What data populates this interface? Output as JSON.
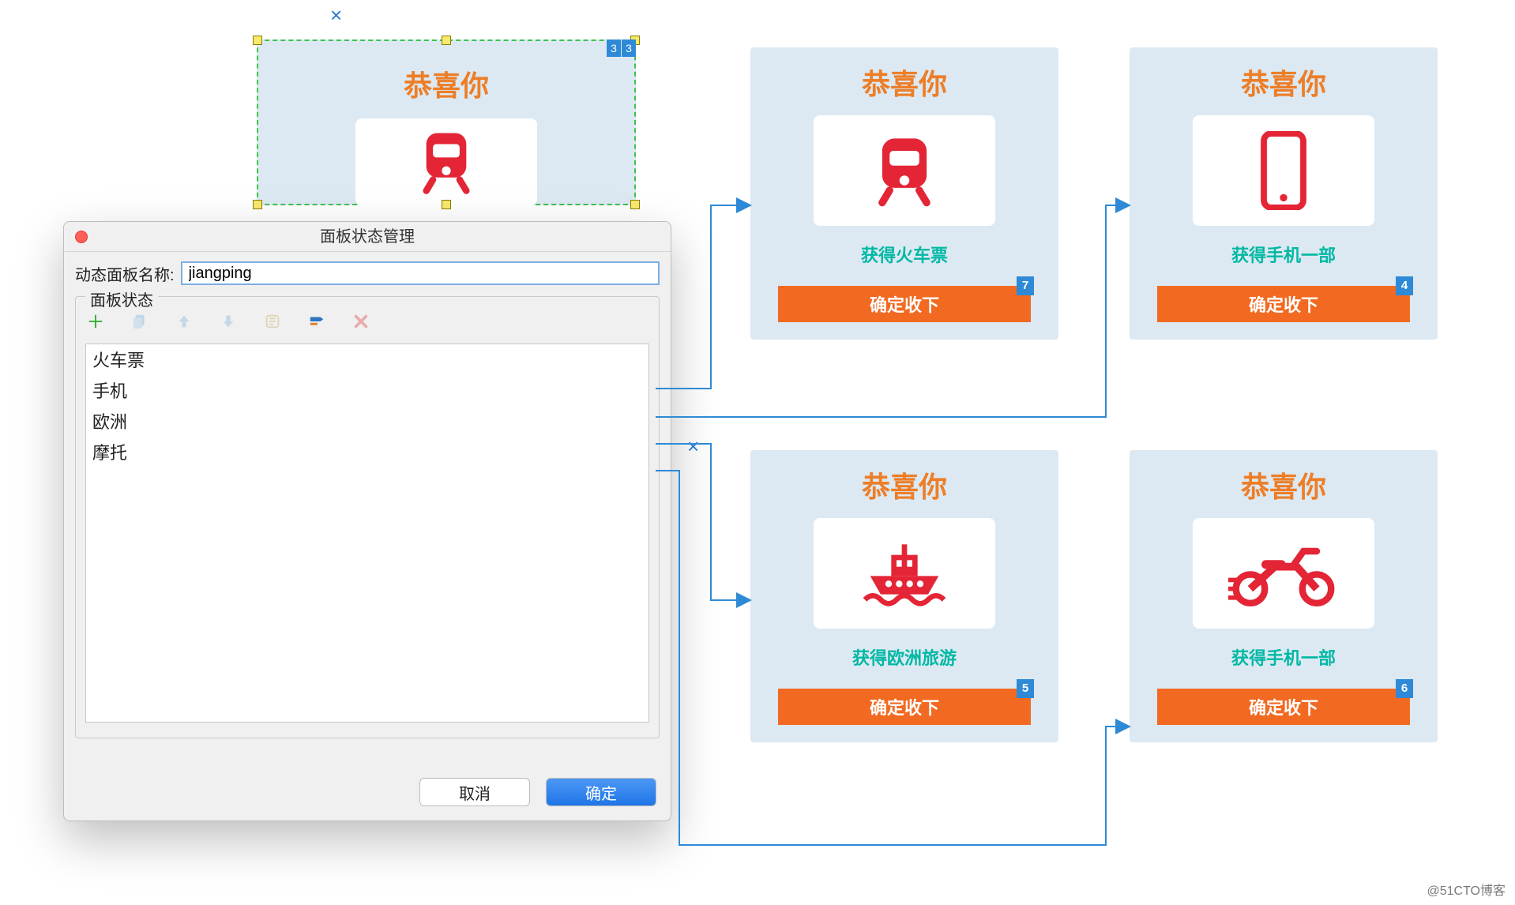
{
  "selected": {
    "title": "恭喜你",
    "close_x": "×",
    "badge_a": "3",
    "badge_b": "3"
  },
  "dialog": {
    "title": "面板状态管理",
    "name_label": "动态面板名称:",
    "name_value": "jiangping",
    "fieldset_legend": "面板状态",
    "states": [
      "火车票",
      "手机",
      "欧洲",
      "摩托"
    ],
    "cancel": "取消",
    "ok": "确定"
  },
  "cards": [
    {
      "title": "恭喜你",
      "subtitle": "获得火车票",
      "button": "确定收下",
      "badge": "7",
      "icon": "train"
    },
    {
      "title": "恭喜你",
      "subtitle": "获得手机一部",
      "button": "确定收下",
      "badge": "4",
      "icon": "phone"
    },
    {
      "title": "恭喜你",
      "subtitle": "获得欧洲旅游",
      "button": "确定收下",
      "badge": "5",
      "icon": "ship"
    },
    {
      "title": "恭喜你",
      "subtitle": "获得手机一部",
      "button": "确定收下",
      "badge": "6",
      "icon": "bike"
    }
  ],
  "close_x_card3": "×",
  "watermark": "@51CTO博客"
}
